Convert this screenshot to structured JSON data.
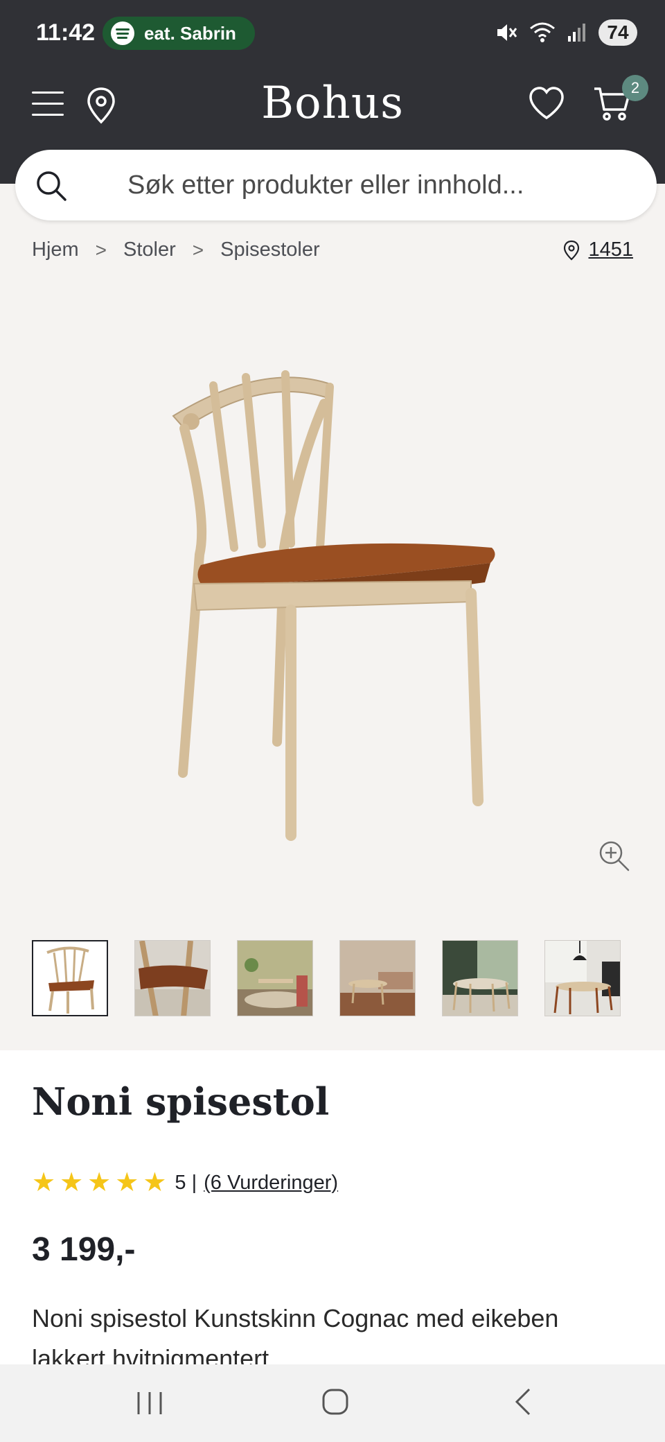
{
  "status_bar": {
    "time": "11:42",
    "now_playing": "eat. Sabrin",
    "battery": "74",
    "icons": [
      "mute-icon",
      "wifi-icon",
      "signal-icon"
    ]
  },
  "header": {
    "brand": "Bohus",
    "cart_count": "2",
    "icons": [
      "menu-icon",
      "location-pin-icon",
      "heart-icon",
      "cart-icon"
    ]
  },
  "search": {
    "placeholder": "Søk etter produkter eller innhold..."
  },
  "breadcrumb": {
    "items": [
      "Hjem",
      "Stoler",
      "Spisestoler"
    ],
    "separator": ">"
  },
  "store": {
    "number": "1451"
  },
  "gallery": {
    "thumbnail_count": 6,
    "active_index": 0
  },
  "product": {
    "title": "Noni spisestol",
    "rating_value": "5 |",
    "rating_stars": 5,
    "reviews_label": "(6 Vurderinger)",
    "price": "3 199,-",
    "description": "Noni spisestol Kunstskinn Cognac med eikeben lakkert hvitpigmentert"
  },
  "colors": {
    "header_bg": "#303136",
    "accent_badge": "#5d8a80",
    "star": "#f5c518",
    "page_bg": "#f5f3f1"
  }
}
